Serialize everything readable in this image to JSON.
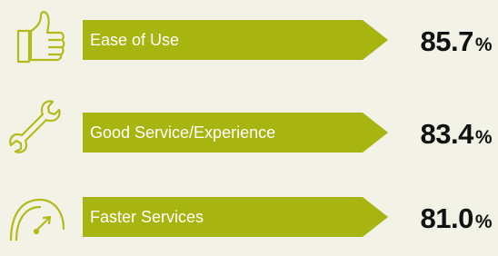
{
  "colors": {
    "background": "#f3f2e6",
    "banner": "#a8b40f",
    "icon_stroke": "#b2bb1a",
    "value_text": "#111111"
  },
  "metrics": [
    {
      "icon": "thumbs-up-icon",
      "label": "Ease of Use",
      "value": "85.7",
      "unit": "%"
    },
    {
      "icon": "wrench-icon",
      "label": "Good Service/Experience",
      "value": "83.4",
      "unit": "%"
    },
    {
      "icon": "speedometer-icon",
      "label": "Faster Services",
      "value": "81.0",
      "unit": "%"
    }
  ]
}
